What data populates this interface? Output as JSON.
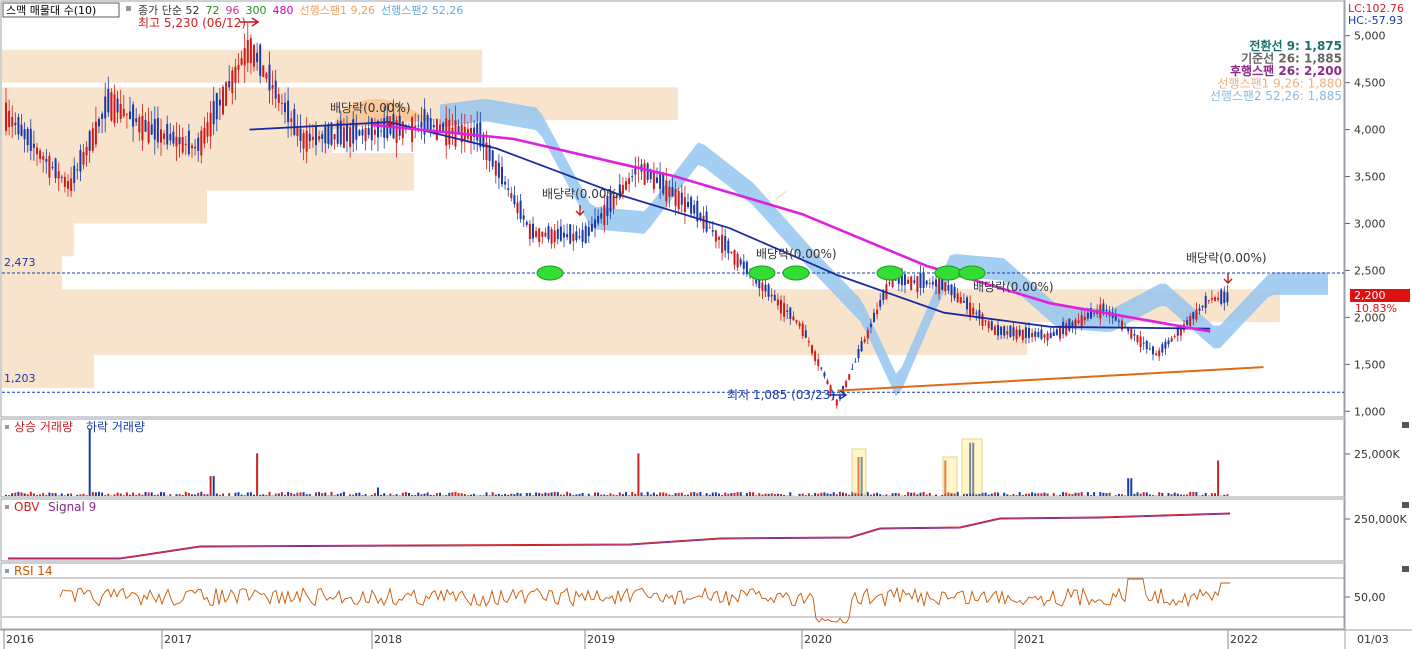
{
  "header": {
    "indicator_box": "스맥 매물대 수(10)",
    "legend": [
      {
        "text": "종가 단순 52",
        "color": "#333333"
      },
      {
        "text": "72",
        "color": "#2a8a2a"
      },
      {
        "text": "96",
        "color": "#cc3399"
      },
      {
        "text": "300",
        "color": "#2a8a2a"
      },
      {
        "text": "480",
        "color": "#cc00cc"
      },
      {
        "text": "선행스팬1 9,26",
        "color": "#f0a060"
      },
      {
        "text": "선행스팬2 52,26",
        "color": "#66aadd"
      }
    ],
    "lc": "LC:102.76",
    "hc": "HC:-57.93"
  },
  "ichimoku_legend": [
    {
      "text": "전환선 9: 1,875",
      "color": "#1a6f6f"
    },
    {
      "text": "기준선 26: 1,885",
      "color": "#666666"
    },
    {
      "text": "후행스팬 26: 2,200",
      "color": "#8a2a8a"
    },
    {
      "text": "선행스팬1 9,26: 1,880",
      "color": "#f0b080"
    },
    {
      "text": "선행스팬2 52,26: 1,885",
      "color": "#88bbdd"
    }
  ],
  "annotations": {
    "high": "최고 5,230 (06/12)",
    "low": "최저 1,085 (03/23)",
    "dividend": "배당락(0.00%)",
    "level_2473": "2,473",
    "level_1203": "1,203"
  },
  "current_price": {
    "label": "2,200",
    "change": "10.83%"
  },
  "chart_data": [
    {
      "type": "candlestick",
      "title": "",
      "x_tick_labels": [
        "2016",
        "2017",
        "2018",
        "2019",
        "2020",
        "2021",
        "2022",
        "01/03"
      ],
      "y_tick_labels": [
        "5,000",
        "4,500",
        "4,000",
        "3,500",
        "3,000",
        "2,500",
        "2,000",
        "1,500",
        "1,000"
      ],
      "ylim": [
        950,
        5380
      ],
      "reference_lines": [
        2473,
        1203
      ],
      "close_series_approx": [
        {
          "date": "2016-01",
          "value": 4200
        },
        {
          "date": "2016-04",
          "value": 3700
        },
        {
          "date": "2016-06",
          "value": 3400
        },
        {
          "date": "2016-09",
          "value": 4300
        },
        {
          "date": "2016-12",
          "value": 4000
        },
        {
          "date": "2017-03",
          "value": 3800
        },
        {
          "date": "2017-06",
          "value": 4900
        },
        {
          "date": "2017-09",
          "value": 3900
        },
        {
          "date": "2017-12",
          "value": 3950
        },
        {
          "date": "2018-04",
          "value": 4050
        },
        {
          "date": "2018-07",
          "value": 3950
        },
        {
          "date": "2018-10",
          "value": 2900
        },
        {
          "date": "2019-01",
          "value": 2850
        },
        {
          "date": "2019-04",
          "value": 3600
        },
        {
          "date": "2019-07",
          "value": 3150
        },
        {
          "date": "2019-10",
          "value": 2500
        },
        {
          "date": "2020-01",
          "value": 1900
        },
        {
          "date": "2020-03",
          "value": 1085
        },
        {
          "date": "2020-06",
          "value": 2400
        },
        {
          "date": "2020-09",
          "value": 2350
        },
        {
          "date": "2020-12",
          "value": 1850
        },
        {
          "date": "2021-03",
          "value": 1800
        },
        {
          "date": "2021-06",
          "value": 2100
        },
        {
          "date": "2021-09",
          "value": 1600
        },
        {
          "date": "2021-12",
          "value": 2200
        }
      ],
      "moving_average_52_approx": [
        {
          "date": "2017-06",
          "value": 4000
        },
        {
          "date": "2018-02",
          "value": 4080
        },
        {
          "date": "2018-08",
          "value": 3800
        },
        {
          "date": "2019-03",
          "value": 3300
        },
        {
          "date": "2019-09",
          "value": 2950
        },
        {
          "date": "2020-03",
          "value": 2450
        },
        {
          "date": "2020-09",
          "value": 2050
        },
        {
          "date": "2021-03",
          "value": 1900
        },
        {
          "date": "2021-12",
          "value": 1880
        }
      ],
      "moving_average_480_approx": [
        {
          "date": "2018-01",
          "value": 4050
        },
        {
          "date": "2018-09",
          "value": 3900
        },
        {
          "date": "2019-06",
          "value": 3500
        },
        {
          "date": "2020-01",
          "value": 3100
        },
        {
          "date": "2020-08",
          "value": 2550
        },
        {
          "date": "2021-03",
          "value": 2150
        },
        {
          "date": "2021-12",
          "value": 1850
        }
      ],
      "trendline_approx": [
        {
          "date": "2020-03",
          "value": 1220
        },
        {
          "date": "2022-03",
          "value": 1470
        }
      ],
      "volume_profile_zones": [
        {
          "low": 4500,
          "high": 4850
        },
        {
          "low": 4100,
          "high": 4450
        },
        {
          "low": 3750,
          "high": 4100
        },
        {
          "low": 3350,
          "high": 3750
        },
        {
          "low": 3000,
          "high": 3350
        },
        {
          "low": 2650,
          "high": 3000
        },
        {
          "low": 2300,
          "high": 2650
        },
        {
          "low": 1950,
          "high": 2300
        },
        {
          "low": 1600,
          "high": 1950
        },
        {
          "low": 1250,
          "high": 1600
        }
      ]
    },
    {
      "type": "bar",
      "title": "",
      "series": [
        {
          "name": "상승 거래량",
          "color": "#cc2222"
        },
        {
          "name": "하락 거래량",
          "color": "#1a3aa8"
        }
      ],
      "y_tick_labels": [
        "25,000K"
      ]
    },
    {
      "type": "line",
      "title": "",
      "series": [
        {
          "name": "OBV",
          "color": "#cc2222"
        },
        {
          "name": "Signal 9",
          "color": "#8a2a8a"
        }
      ],
      "y_tick_labels": [
        "250,000K"
      ]
    },
    {
      "type": "line",
      "title": "",
      "series": [
        {
          "name": "RSI 14",
          "color": "#cc5500"
        }
      ],
      "y_tick_labels": [
        "50,00"
      ]
    }
  ]
}
